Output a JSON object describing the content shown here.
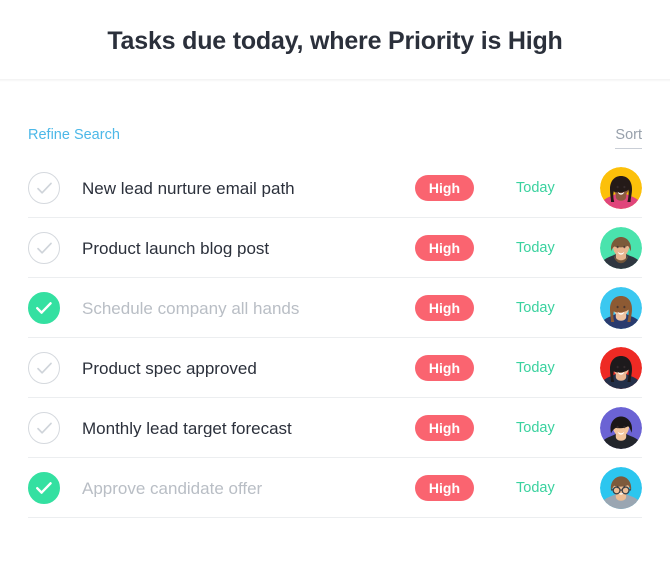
{
  "header": {
    "title": "Tasks due today, where Priority is High"
  },
  "toolbar": {
    "refine_search_label": "Refine Search",
    "sort_label": "Sort"
  },
  "colors": {
    "accent_blue": "#4cb8e8",
    "priority_high_bg": "#fa6470",
    "due_green": "#3ad29f",
    "checked_green": "#34e0a1",
    "title_text": "#2b303b",
    "done_text": "#b9bec5",
    "divider": "#eceef0"
  },
  "tasks": [
    {
      "title": "New lead nurture email path",
      "completed": false,
      "checkbox_icon": "circle-check-outline-icon",
      "priority": "High",
      "due": "Today",
      "avatar": {
        "icon": "avatar-icon",
        "bg": "#fcc00a",
        "skin": "#8d5a40",
        "hair": "#241a18",
        "shirt": "#e0457b",
        "style": "long-hair"
      }
    },
    {
      "title": "Product launch blog post",
      "completed": false,
      "checkbox_icon": "circle-check-outline-icon",
      "priority": "High",
      "due": "Today",
      "avatar": {
        "icon": "avatar-icon",
        "bg": "#4ae3ad",
        "skin": "#e7b58f",
        "hair": "#7b5a3a",
        "shirt": "#2f3640",
        "style": "beard"
      }
    },
    {
      "title": "Schedule company all hands",
      "completed": true,
      "checkbox_icon": "circle-check-filled-icon",
      "priority": "High",
      "due": "Today",
      "avatar": {
        "icon": "avatar-icon",
        "bg": "#3bc8f0",
        "skin": "#f0c3a0",
        "hair": "#8d5a33",
        "shirt": "#2a3b6e",
        "style": "long-hair"
      }
    },
    {
      "title": "Product spec approved",
      "completed": false,
      "checkbox_icon": "circle-check-outline-icon",
      "priority": "High",
      "due": "Today",
      "avatar": {
        "icon": "avatar-icon",
        "bg": "#ee2a24",
        "skin": "#eab693",
        "hair": "#1d1a1c",
        "shirt": "#243049",
        "style": "long-hair"
      }
    },
    {
      "title": "Monthly lead target forecast",
      "completed": false,
      "checkbox_icon": "circle-check-outline-icon",
      "priority": "High",
      "due": "Today",
      "avatar": {
        "icon": "avatar-icon",
        "bg": "#6b63d4",
        "skin": "#f2c49c",
        "hair": "#1b1718",
        "shirt": "#22252b",
        "style": "short-hair"
      }
    },
    {
      "title": "Approve candidate offer",
      "completed": true,
      "checkbox_icon": "circle-check-filled-icon",
      "priority": "High",
      "due": "Today",
      "avatar": {
        "icon": "avatar-icon",
        "bg": "#2cc6ef",
        "skin": "#edbd95",
        "hair": "#7d5a3c",
        "shirt": "#9aa6b2",
        "style": "glasses"
      }
    }
  ]
}
